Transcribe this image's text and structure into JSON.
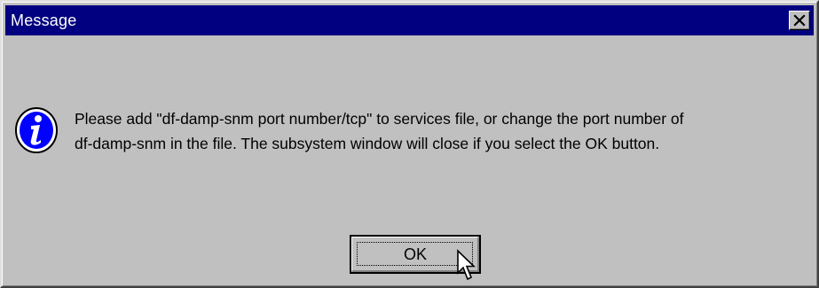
{
  "window": {
    "title": "Message",
    "close_glyph": "×"
  },
  "message": {
    "line1": "Please add \"df-damp-snm port number/tcp\" to services file, or change the port number of",
    "line2": "df-damp-snm in the file. The subsystem window will close if you select the OK button.",
    "icon": "info-icon"
  },
  "buttons": {
    "ok_label": "OK"
  },
  "colors": {
    "titlebar": "#000080",
    "face": "#c0c0c0",
    "icon_blue": "#0000ff"
  }
}
